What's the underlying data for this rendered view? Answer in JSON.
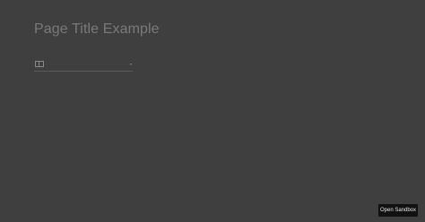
{
  "page": {
    "title": "Page Title Example"
  },
  "select": {
    "value": "",
    "flag_icon": "flag-icon",
    "chevron_icon": "chevron-down-icon"
  },
  "footer": {
    "open_sandbox_label": "Open Sandbox"
  },
  "colors": {
    "background": "#3f3f3f",
    "title_text": "#7a7a7a",
    "button_background": "#111111",
    "button_text": "#e6e6e6"
  }
}
